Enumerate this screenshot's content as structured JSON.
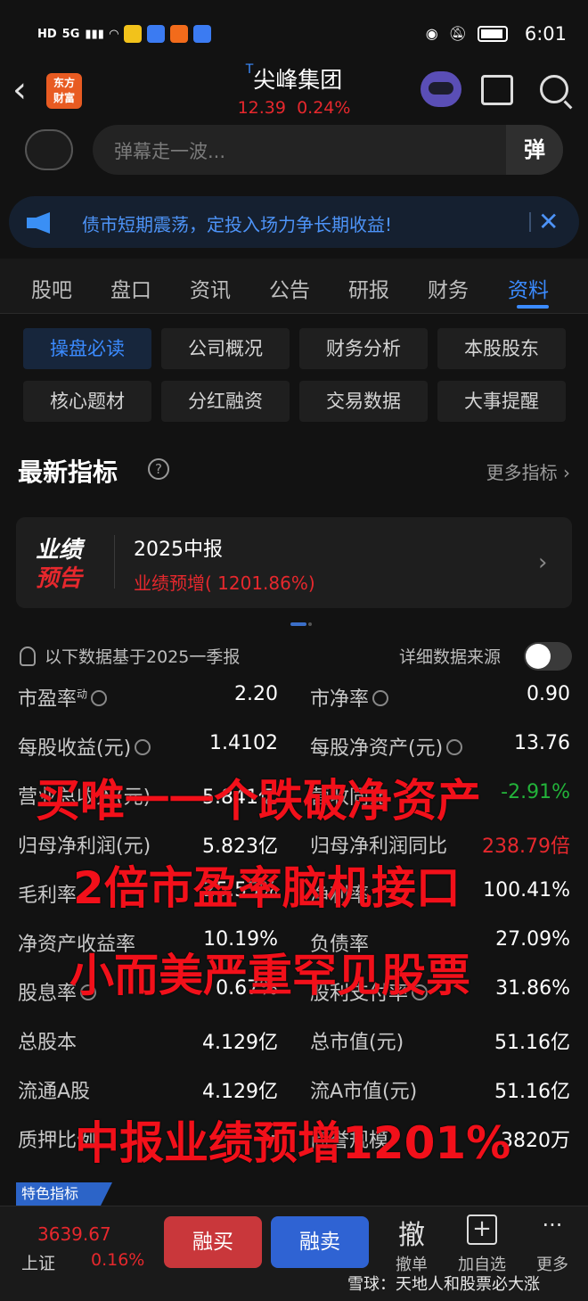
{
  "status_bar": {
    "left_labels": [
      "HD",
      "5G"
    ],
    "time": "6:01"
  },
  "header": {
    "back_label": "‹",
    "logo_line1": "东方",
    "logo_line2": "财富",
    "t_mark": "T",
    "stock_name": "尖峰集团",
    "price": "12.39",
    "change_pct": "0.24%"
  },
  "danmaku": {
    "placeholder": "弹幕走一波...",
    "send_label": "弹"
  },
  "notice": {
    "text": "债市短期震荡，定投入场力争长期收益!",
    "close_label": "✕"
  },
  "tabs": [
    "股吧",
    "盘口",
    "资讯",
    "公告",
    "研报",
    "财务",
    "资料"
  ],
  "active_tab": "资料",
  "sub_nav": [
    "操盘必读",
    "公司概况",
    "财务分析",
    "本股股东",
    "核心题材",
    "分红融资",
    "交易数据",
    "大事提醒"
  ],
  "section": {
    "title": "最新指标",
    "help": "?",
    "more": "更多指标 ›"
  },
  "forecast": {
    "badge_line1": "业绩",
    "badge_line2": "预告",
    "period": "2025中报",
    "desc": "业绩预增( 1201.86%)",
    "arrow": "›"
  },
  "basis": {
    "text": "以下数据基于2025一季报",
    "source_label": "详细数据来源"
  },
  "metrics": [
    {
      "left_label": "市盈率",
      "left_sup": "动",
      "left_val": "2.20",
      "right_label": "市净率",
      "right_val": "0.90"
    },
    {
      "left_label": "每股收益(元)",
      "left_val": "1.4102",
      "right_label": "每股净资产(元)",
      "right_val": "13.76"
    },
    {
      "left_label": "营业总收入(元)",
      "left_val": "5.841亿",
      "right_label": "营收同比",
      "right_val": "-2.91%"
    },
    {
      "left_label": "归母净利润(元)",
      "left_val": "5.823亿",
      "right_label": "归母净利润同比",
      "right_val": "238.79倍"
    },
    {
      "left_label": "毛利率",
      "left_val": "25.55%",
      "right_label": "净利率",
      "right_val": "100.41%"
    },
    {
      "left_label": "净资产收益率",
      "left_val": "10.19%",
      "right_label": "负债率",
      "right_val": "27.09%"
    },
    {
      "left_label": "股息率",
      "left_val": "0.67%",
      "right_label": "股利支付率",
      "right_val": "31.86%"
    },
    {
      "left_label": "总股本",
      "left_val": "4.129亿",
      "right_label": "总市值(元)",
      "right_val": "51.16亿"
    },
    {
      "left_label": "流通A股",
      "left_val": "4.129亿",
      "right_label": "流A市值(元)",
      "right_val": "51.16亿"
    },
    {
      "left_label": "质押比例",
      "left_val": "-",
      "right_label": "商誉规模",
      "right_val": "3820万"
    }
  ],
  "overlay_captions": [
    "买唯一一个跌破净资产",
    "2倍市盈率脑机接口",
    "小而美严重罕见股票",
    "中报业绩预增1201%"
  ],
  "feature_tag": "特色指标",
  "bottom_bar": {
    "index_value": "3639.67",
    "index_name": "上证",
    "index_change": "0.16%",
    "buy_label": "融买",
    "sell_label": "融卖",
    "cancel_icon": "撤",
    "cancel_label": "撤单",
    "add_icon": "+",
    "add_label": "加自选",
    "more_icon": "···",
    "more_label": "更多"
  },
  "watermark": "雪球：天地人和股票必大涨",
  "colors": {
    "up_red": "#e6282d",
    "down_green": "#23b33a",
    "accent_blue": "#3b8bff",
    "background": "#121212"
  }
}
